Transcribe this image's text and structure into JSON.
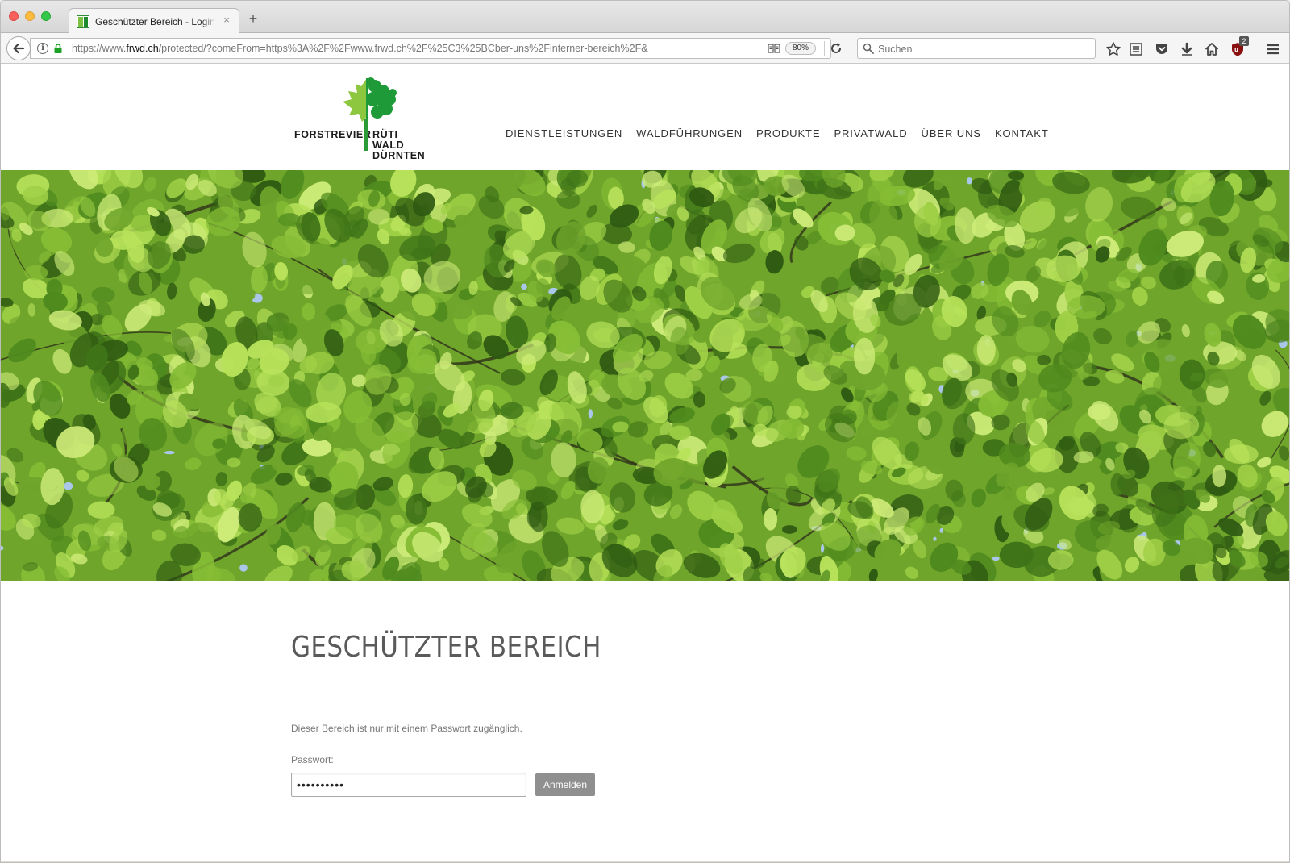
{
  "browser": {
    "tab_title": "Geschützter Bereich - Login - F",
    "new_tab_symbol": "+",
    "close_symbol": "×",
    "url_prefix": "https://www.",
    "url_host": "frwd.ch",
    "url_rest": "/protected/?comeFrom=https%3A%2F%2Fwww.frwd.ch%2F%25C3%25BCber-uns%2Finterner-bereich%2F&",
    "zoom": "80%",
    "search_placeholder": "Suchen",
    "addon_badge": "2"
  },
  "logo": {
    "line1": "FORSTREVIER",
    "line1b": "RÜTI",
    "line2": "WALD",
    "line3": "DÜRNTEN",
    "colors": {
      "light_leaf": "#8dc63f",
      "dark_tree": "#1f9a38"
    }
  },
  "nav": {
    "items": [
      "DIENSTLEISTUNGEN",
      "WALDFÜHRUNGEN",
      "PRODUKTE",
      "PRIVATWALD",
      "ÜBER UNS",
      "KONTAKT"
    ]
  },
  "content": {
    "title": "GESCHÜTZTER BEREICH",
    "intro": "Dieser Bereich ist nur mit einem Passwort zugänglich.",
    "password_label": "Passwort:",
    "password_value": "••••••••••",
    "submit_label": "Anmelden"
  },
  "colors": {
    "foliage_dark": "#2f5a12",
    "foliage_mid": "#6fa52b",
    "foliage_light": "#b8e25a",
    "button_grey": "#8f8f8f"
  }
}
